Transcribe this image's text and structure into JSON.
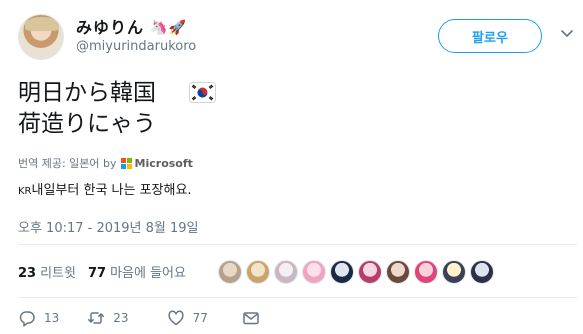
{
  "tweet": {
    "author": {
      "display_name": "みゆりん",
      "name_emoji": "🦄🚀",
      "handle": "@miyurindarukoro"
    },
    "follow_label": "팔로우",
    "text": "明日から韓国\n荷造りにゃう",
    "flag_icon": "south-korea-flag-icon",
    "translation": {
      "credit_label": "번역 제공: 일본어 by",
      "provider": "Microsoft",
      "prefix": "KR",
      "text": "내일부터 한국 나는 포장해요."
    },
    "timestamp": "오후 10:17 - 2019년 8월 19일",
    "stats": {
      "retweets_count": "23",
      "retweets_label": "리트윗",
      "likes_count": "77",
      "likes_label": "마음에 들어요"
    },
    "likers_count": 10,
    "actions": {
      "replies": "13",
      "retweets": "23",
      "likes": "77"
    },
    "colors": {
      "accent": "#1da1f2",
      "muted": "#657786",
      "divider": "#e6ecf0"
    }
  }
}
